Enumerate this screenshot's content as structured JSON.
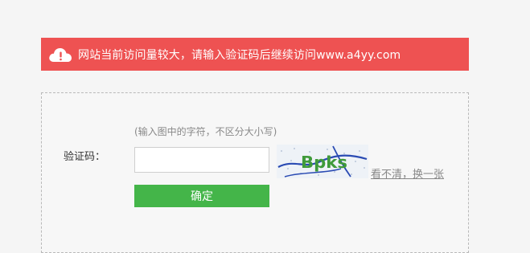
{
  "alert": {
    "icon": "warning-cloud-icon",
    "message": "网站当前访问量较大，请输入验证码后继续访问www.a4yy.com",
    "color": "#ee5252"
  },
  "form": {
    "hint": "(输入图中的字符，不区分大小写)",
    "label": "验证码：",
    "input_value": "",
    "captcha_text": "Bpks",
    "refresh_link": "看不清，换一张",
    "submit_label": "确定",
    "submit_color": "#44b549"
  }
}
